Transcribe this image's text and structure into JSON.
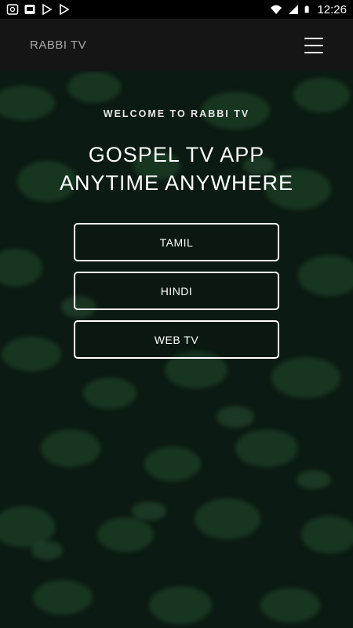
{
  "status_bar": {
    "time": "12:26",
    "left_icons": [
      "cast-icon",
      "screen-icon",
      "play-store-icon",
      "play-store-icon"
    ],
    "right_icons": [
      "wifi-icon",
      "signal-icon",
      "battery-icon"
    ]
  },
  "app_bar": {
    "title": "RABBI TV",
    "menu_icon": "hamburger-menu-icon"
  },
  "hero": {
    "welcome": "WELCOME TO RABBI TV",
    "headline_line1": "GOSPEL TV APP",
    "headline_line2": "ANYTIME ANYWHERE"
  },
  "buttons": [
    {
      "label": "TAMIL"
    },
    {
      "label": "HINDI"
    },
    {
      "label": "WEB TV"
    }
  ],
  "colors": {
    "status_bar": "#000000",
    "app_bar": "#151515",
    "button_border": "#ffffff",
    "background_green": "#0f2016"
  }
}
